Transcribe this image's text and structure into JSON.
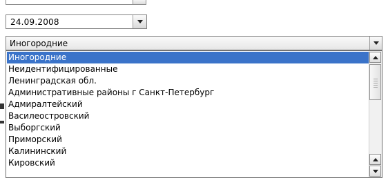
{
  "date_field": {
    "value": "24.09.2008"
  },
  "region_select": {
    "selected": "Иногородние",
    "options": [
      "Иногородние",
      "Неидентифицированные",
      "Ленинградская обл.",
      "Административные районы г Санкт-Петербург",
      "Адмиралтейский",
      "Василеостровский",
      "Выборгский",
      "Приморский",
      "Калининский",
      "Кировский"
    ],
    "highlighted_index": 0
  },
  "icons": {
    "dropdown": "chevron-down-icon",
    "scroll_up": "arrow-up-icon",
    "scroll_down": "arrow-down-icon"
  },
  "colors": {
    "selection": "#3a73c9"
  }
}
